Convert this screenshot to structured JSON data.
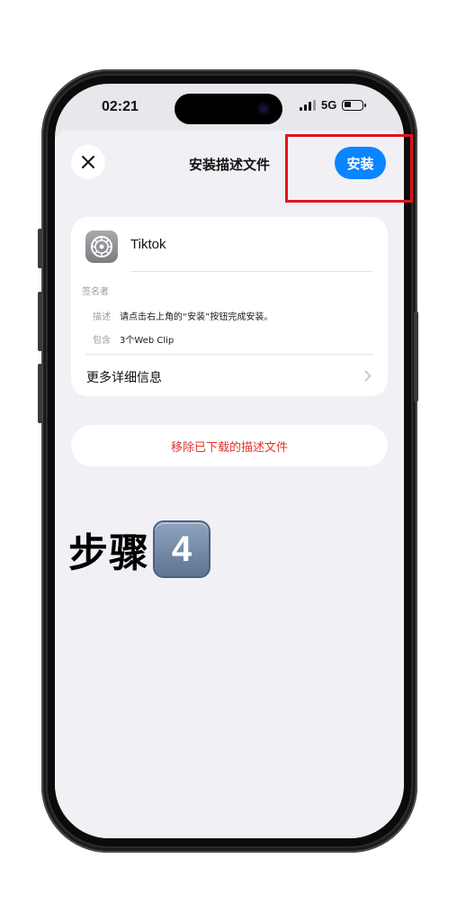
{
  "status_bar": {
    "time": "02:21",
    "network": "5G",
    "icons": [
      "signal-icon",
      "battery-icon"
    ]
  },
  "sheet": {
    "title": "安装描述文件",
    "close_icon": "close-icon",
    "install_label": "安装"
  },
  "profile": {
    "app_name": "Tiktok",
    "app_icon": "settings-gear-icon",
    "signer_label": "签名者",
    "rows": [
      {
        "label": "描述",
        "value": "请点击右上角的“安装”按钮完成安装。"
      },
      {
        "label": "包含",
        "value": "3个Web Clip"
      }
    ],
    "more_info_label": "更多详细信息"
  },
  "remove_label": "移除已下载的描述文件",
  "caption": {
    "text": "步骤",
    "keycap": "4"
  },
  "colors": {
    "accent": "#0a84ff",
    "destructive": "#e5322d",
    "highlight": "#e2141c"
  }
}
